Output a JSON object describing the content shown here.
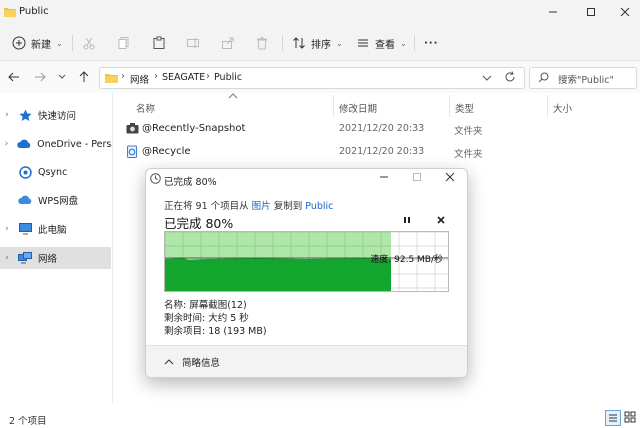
{
  "window": {
    "title": "Public",
    "accent": "#0067c0"
  },
  "toolbar": {
    "new_label": "新建",
    "sort_label": "排序",
    "view_label": "查看",
    "more_label": "···"
  },
  "address": {
    "crumbs": [
      "网络",
      "SEAGATE",
      "Public"
    ],
    "search_placeholder": "搜索\"Public\""
  },
  "sidebar": {
    "items": [
      {
        "label": "快速访问",
        "icon": "star-icon",
        "selected": false
      },
      {
        "label": "OneDrive - Personal",
        "icon": "cloud-icon",
        "selected": false
      },
      {
        "label": "Qsync",
        "icon": "sync-icon",
        "selected": false
      },
      {
        "label": "WPS网盘",
        "icon": "cloud-icon",
        "selected": false
      },
      {
        "label": "此电脑",
        "icon": "monitor-icon",
        "selected": false
      },
      {
        "label": "网络",
        "icon": "network-icon",
        "selected": true
      }
    ]
  },
  "list": {
    "columns": [
      "名称",
      "修改日期",
      "类型",
      "大小"
    ],
    "rows": [
      {
        "name": "@Recently-Snapshot",
        "date": "2021/12/20 20:33",
        "type": "文件夹",
        "icon": "camera-folder-icon"
      },
      {
        "name": "@Recycle",
        "date": "2021/12/20 20:33",
        "type": "文件夹",
        "icon": "recycle-icon"
      }
    ]
  },
  "status": {
    "count": "2 个项目"
  },
  "dialog": {
    "title": "已完成 80%",
    "subtitle_prefix": "正在将 91 个项目从",
    "source": "图片",
    "action": "复制到",
    "destination": "Public",
    "heading": "已完成 80%",
    "progress": 0.8,
    "speed": "速度: 92.5 MB/秒",
    "name_line": "名称: 屏幕截图(12)",
    "time_line": "剩余时间: 大约 5 秒",
    "items_line": "剩余项目: 18 (193 MB)",
    "details_label": "简略信息",
    "colors": {
      "done_light": "#a6e3a0",
      "done_dark": "#13a62f",
      "accent": "#1a62c4"
    }
  }
}
